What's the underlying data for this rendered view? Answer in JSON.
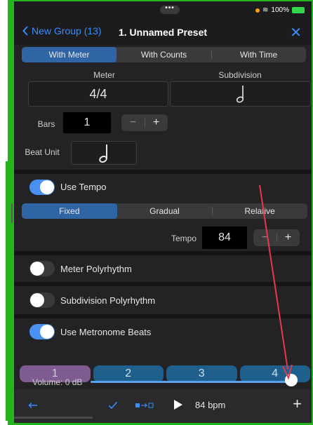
{
  "status": {
    "dots": "•••",
    "battery": "100%"
  },
  "nav": {
    "back_label": "New Group (13)",
    "title": "1. Unnamed Preset",
    "close": "✕"
  },
  "mode_tabs": [
    "With Meter",
    "With Counts",
    "With Time"
  ],
  "meter": {
    "meter_label": "Meter",
    "meter_value": "4/4",
    "subdivision_label": "Subdivision",
    "subdivision_icon": "half-note"
  },
  "bars": {
    "label": "Bars",
    "value": "1",
    "minus": "−",
    "plus": "+"
  },
  "beat_unit": {
    "label": "Beat Unit",
    "icon": "half-note"
  },
  "tempo_section": {
    "toggle_label": "Use Tempo",
    "toggle_on": true,
    "tabs": [
      "Fixed",
      "Gradual",
      "Relative"
    ],
    "tempo_label": "Tempo",
    "tempo_value": "84",
    "minus": "−",
    "plus": "+"
  },
  "meter_poly": {
    "label": "Meter Polyrhythm",
    "on": false
  },
  "subdiv_poly": {
    "label": "Subdivision Polyrhythm",
    "on": false
  },
  "metronome": {
    "label": "Use Metronome Beats",
    "on": true,
    "beats": [
      "1",
      "2",
      "3",
      "4"
    ]
  },
  "volume": {
    "label": "Volume:  0 dB",
    "level": 1.0
  },
  "toolbar": {
    "back_icon": "left-arrow-icon",
    "check_icon": "checkmark-icon",
    "mode_icon": "square-arrow-square-icon",
    "play_icon": "play-icon",
    "bpm": "84 bpm",
    "add": "+"
  },
  "colors": {
    "accent": "#3a8cff",
    "segment_active": "#2f64a5",
    "beat": "#1f5f8b",
    "beat_first": "#7e5c92",
    "annotation_arrow": "#e8384f",
    "frame": "#25b41d"
  }
}
